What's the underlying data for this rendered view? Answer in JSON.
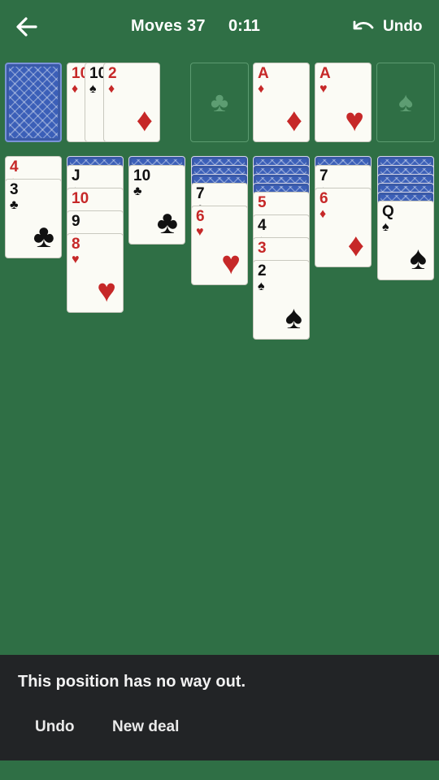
{
  "header": {
    "moves_label": "Moves 37",
    "timer": "0:11",
    "undo_label": "Undo"
  },
  "icons": {
    "back": "back-arrow-icon",
    "undo": "undo-icon"
  },
  "stock": {
    "face": "down"
  },
  "waste": [
    {
      "rank": "10",
      "suit": "♦",
      "color": "red"
    },
    {
      "rank": "10",
      "suit": "♠",
      "color": "black"
    },
    {
      "rank": "2",
      "suit": "♦",
      "color": "red"
    }
  ],
  "foundations": [
    {
      "empty": true,
      "ghost_suit": "♣"
    },
    {
      "rank": "A",
      "suit": "♦",
      "color": "red"
    },
    {
      "rank": "A",
      "suit": "♥",
      "color": "red"
    },
    {
      "empty": true,
      "ghost_suit": "♠"
    }
  ],
  "tableau": [
    {
      "hidden": 0,
      "cards": [
        {
          "rank": "4",
          "suit": "♦",
          "color": "red"
        },
        {
          "rank": "3",
          "suit": "♣",
          "color": "black"
        }
      ]
    },
    {
      "hidden": 1,
      "cards": [
        {
          "rank": "J",
          "suit": "♠",
          "color": "black"
        },
        {
          "rank": "10",
          "suit": "♥",
          "color": "red"
        },
        {
          "rank": "9",
          "suit": "♠",
          "color": "black"
        },
        {
          "rank": "8",
          "suit": "♥",
          "color": "red"
        }
      ]
    },
    {
      "hidden": 1,
      "cards": [
        {
          "rank": "10",
          "suit": "♣",
          "color": "black"
        }
      ]
    },
    {
      "hidden": 3,
      "cards": [
        {
          "rank": "7",
          "suit": "♣",
          "color": "black"
        },
        {
          "rank": "6",
          "suit": "♥",
          "color": "red"
        }
      ]
    },
    {
      "hidden": 4,
      "cards": [
        {
          "rank": "5",
          "suit": "♥",
          "color": "red"
        },
        {
          "rank": "4",
          "suit": "♠",
          "color": "black"
        },
        {
          "rank": "3",
          "suit": "♥",
          "color": "red"
        },
        {
          "rank": "2",
          "suit": "♠",
          "color": "black"
        }
      ]
    },
    {
      "hidden": 1,
      "cards": [
        {
          "rank": "7",
          "suit": "♠",
          "color": "black"
        },
        {
          "rank": "6",
          "suit": "♦",
          "color": "red"
        }
      ]
    },
    {
      "hidden": 5,
      "cards": [
        {
          "rank": "Q",
          "suit": "♠",
          "color": "black"
        }
      ]
    }
  ],
  "dialog": {
    "message": "This position has no way out.",
    "undo_label": "Undo",
    "new_deal_label": "New deal"
  },
  "colors": {
    "felt": "#2f6f45",
    "card_face": "#fbfbf5",
    "card_back": "#3b5fb8",
    "red_suit": "#c62828",
    "banner": "#222426"
  }
}
